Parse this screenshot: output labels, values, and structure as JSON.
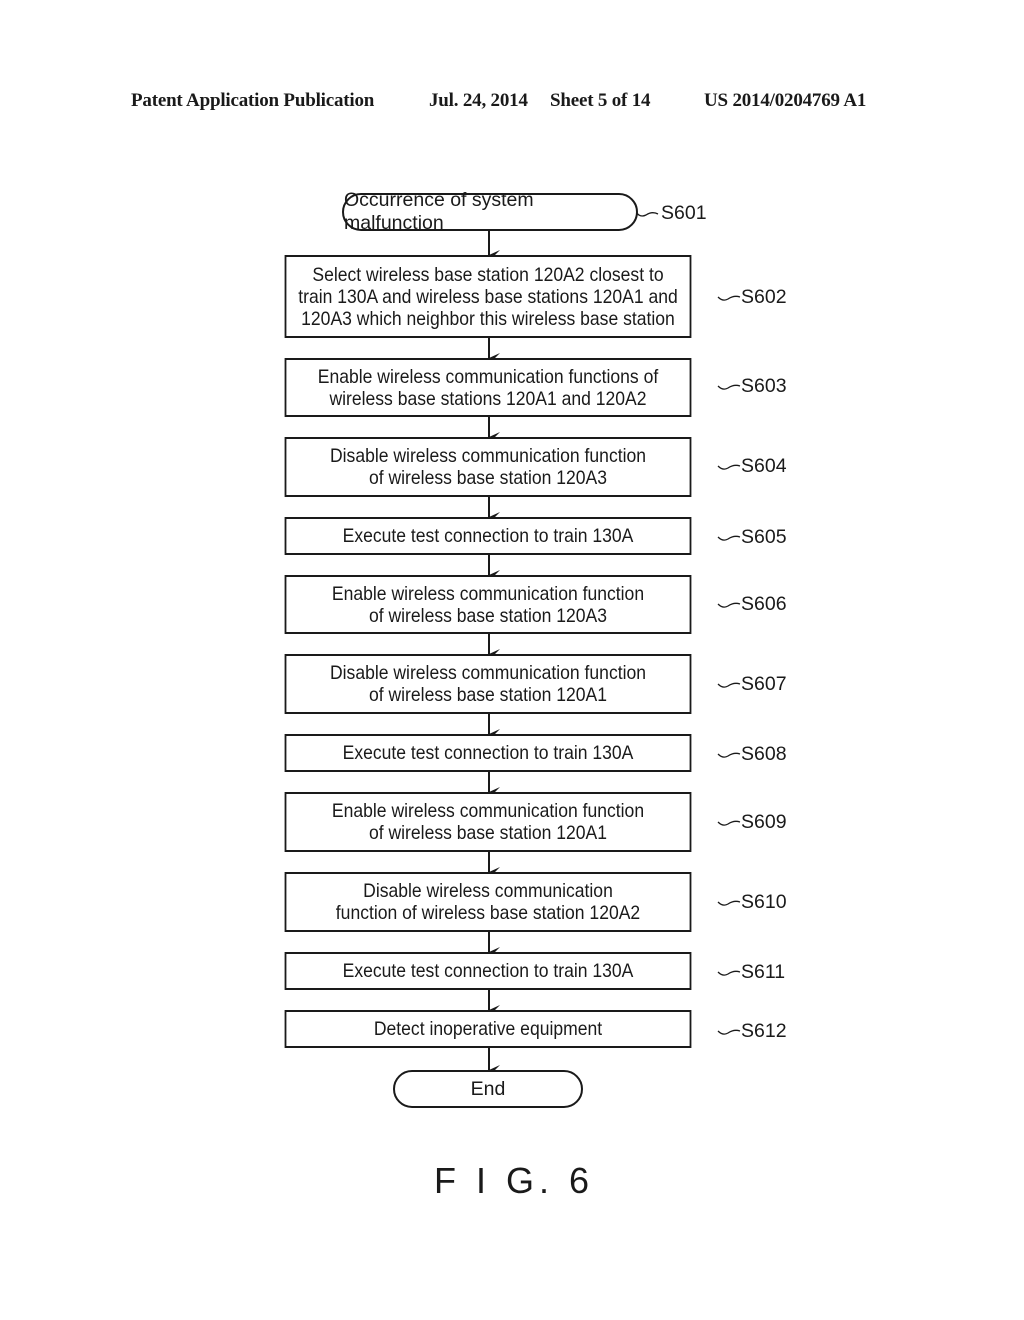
{
  "header": {
    "publication_type": "Patent Application Publication",
    "date": "Jul. 24, 2014",
    "sheet": "Sheet 5 of 14",
    "publication_number": "US 2014/0204769 A1"
  },
  "flowchart": {
    "start": {
      "id": "S601",
      "text": "Occurrence of system malfunction"
    },
    "steps": [
      {
        "id": "S602",
        "text": "Select wireless base station 120A2 closest to\ntrain 130A and wireless base stations 120A1 and\n120A3 which neighbor this wireless base station"
      },
      {
        "id": "S603",
        "text": "Enable wireless communication functions of\nwireless base stations 120A1 and 120A2"
      },
      {
        "id": "S604",
        "text": "Disable wireless communication function\nof wireless base station 120A3"
      },
      {
        "id": "S605",
        "text": "Execute test connection to train 130A"
      },
      {
        "id": "S606",
        "text": "Enable wireless communication function\nof wireless base station 120A3"
      },
      {
        "id": "S607",
        "text": "Disable wireless communication function\nof wireless base station 120A1"
      },
      {
        "id": "S608",
        "text": "Execute test connection to train 130A"
      },
      {
        "id": "S609",
        "text": "Enable wireless communication function\nof wireless base station 120A1"
      },
      {
        "id": "S610",
        "text": "Disable wireless communication\nfunction of wireless base station 120A2"
      },
      {
        "id": "S611",
        "text": "Execute test connection to train 130A"
      },
      {
        "id": "S612",
        "text": "Detect inoperative equipment"
      }
    ],
    "end": {
      "text": "End"
    }
  },
  "figure_label": "F I G. 6"
}
